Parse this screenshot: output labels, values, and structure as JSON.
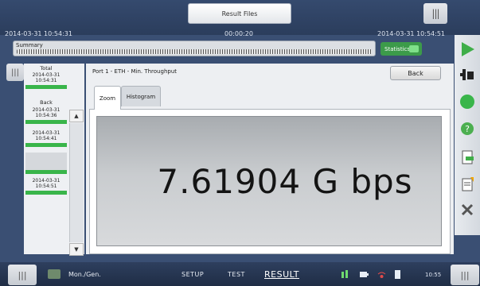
{
  "header": {
    "result_files_tab": "Result Files",
    "start_time": "2014-03-31 10:54:31",
    "elapsed": "00:00:20",
    "end_time": "2014-03-31 10:54:51"
  },
  "summary": {
    "label": "Summary",
    "statistics_label": "Statistics"
  },
  "timeline": {
    "total_label": "Total",
    "total_stamp_date": "2014-03-31",
    "total_stamp_time": "10:54:31",
    "back_label": "Back",
    "entries": [
      {
        "date": "2014-03-31",
        "time": "10:54:36"
      },
      {
        "date": "2014-03-31",
        "time": "10:54:41"
      },
      {
        "date": "2014-03-31",
        "time": "10:54:51"
      }
    ]
  },
  "main": {
    "port_title": "Port 1 - ETH - Min. Throughput",
    "back_button": "Back",
    "tabs": [
      "Zoom",
      "Histogram"
    ],
    "active_tab": "Zoom",
    "value": "7.61904 G bps"
  },
  "footer": {
    "mode": "Mon./Gen.",
    "nav": [
      "SETUP",
      "TEST",
      "RESULT"
    ],
    "active_nav": "RESULT",
    "clock": "10:55"
  },
  "colors": {
    "accent_green": "#39b54a",
    "header_bg": "#2b3d5c"
  }
}
